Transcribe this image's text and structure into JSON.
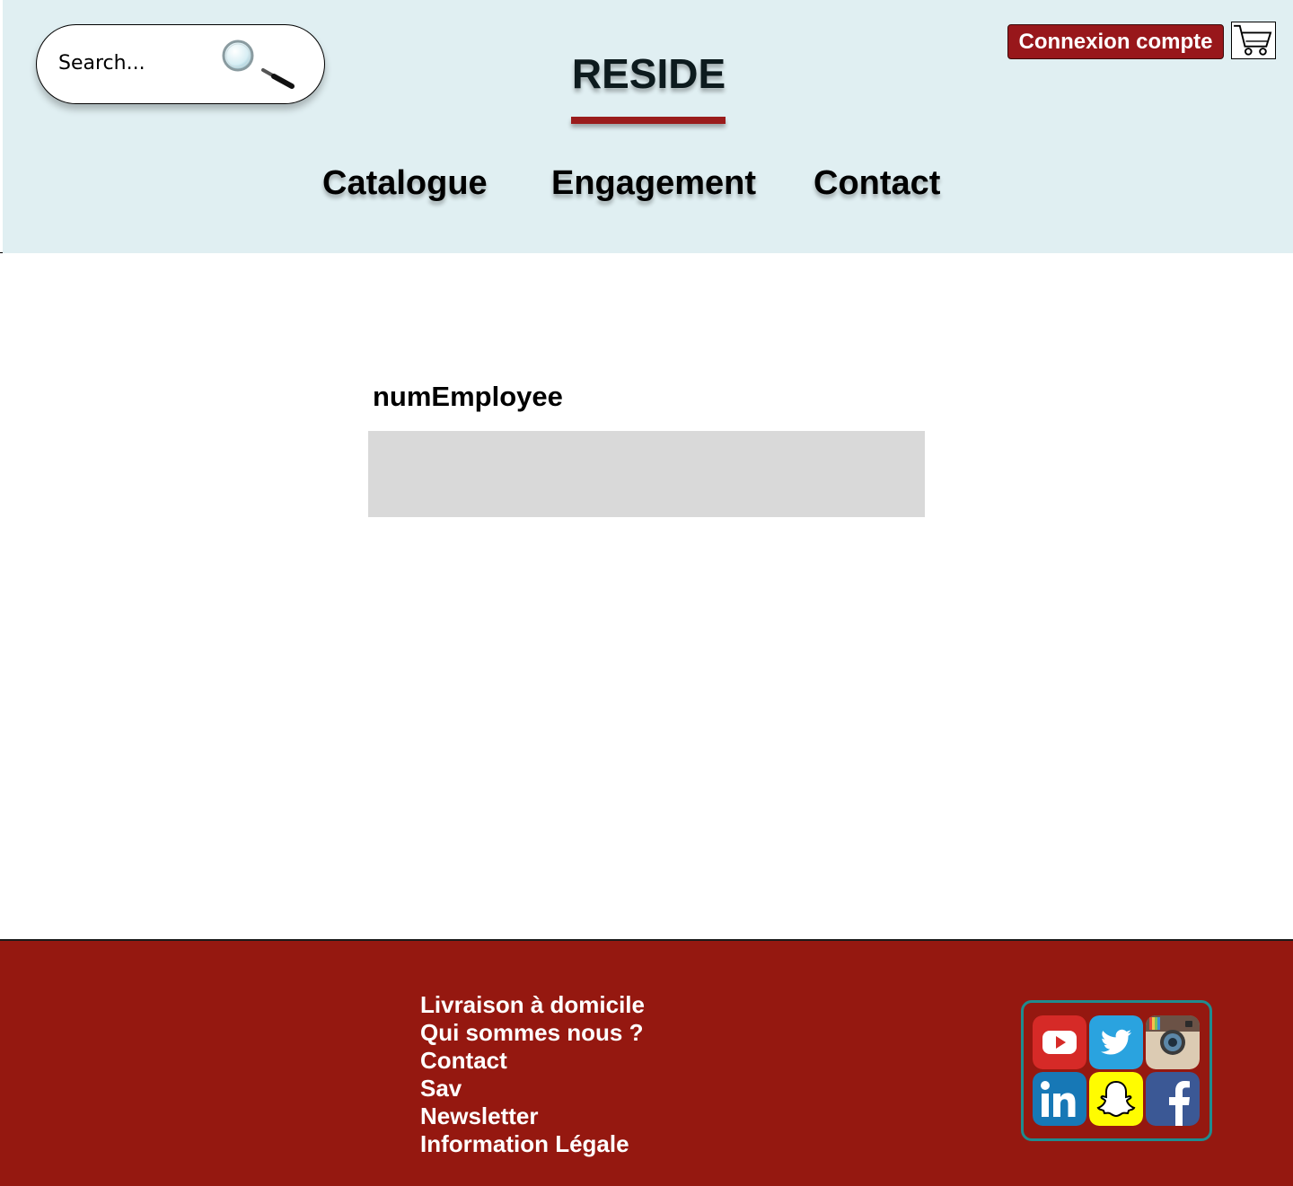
{
  "header": {
    "search_placeholder": "Search...",
    "logo": "RESIDE",
    "login_label": "Connexion compte",
    "nav": [
      "Catalogue",
      "Engagement",
      "Contact"
    ]
  },
  "main": {
    "field_label": "numEmployee",
    "field_value": ""
  },
  "footer": {
    "links": [
      "Livraison à domicile",
      "Qui sommes nous ?",
      "Contact",
      "Sav",
      "Newsletter",
      "Information Légale"
    ],
    "social": [
      "youtube-icon",
      "twitter-icon",
      "instagram-icon",
      "linkedin-icon",
      "snapchat-icon",
      "facebook-icon"
    ]
  },
  "colors": {
    "header_bg": "#e0eff2",
    "accent_red": "#98171b",
    "footer_bg": "#951810",
    "field_bg": "#d9d9d9",
    "social_border": "#1f8c8f"
  }
}
